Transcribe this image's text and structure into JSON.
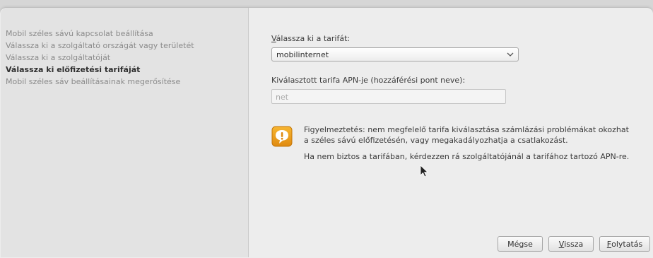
{
  "sidebar": {
    "steps": [
      {
        "label": "Mobil széles sávú kapcsolat beállítása",
        "active": false
      },
      {
        "label": "Válassza ki a szolgáltató országát vagy területét",
        "active": false
      },
      {
        "label": "Válassza ki a szolgáltatóját",
        "active": false
      },
      {
        "label": "Válassza ki előfizetési tarifáját",
        "active": true
      },
      {
        "label": "Mobil széles sáv beállításainak megerősítése",
        "active": false
      }
    ]
  },
  "main": {
    "plan_label_mnemonic": "V",
    "plan_label_rest": "álassza ki a tarifát:",
    "plan_selected": "mobilinternet",
    "apn_label": "Kiválasztott tarifa APN-je (hozzáférési pont neve):",
    "apn_value": "net",
    "warning_line1": "Figyelmeztetés: nem megfelelő tarifa kiválasztása számlázási problémákat okozhat",
    "warning_line2": "a széles sávú előfizetésén, vagy megakadályozhatja a csatlakozást.",
    "warning_line3": "Ha nem biztos a tarifában, kérdezzen rá szolgáltatójánál a tarifához tartozó APN-re."
  },
  "buttons": {
    "cancel": "Mégse",
    "back_mnemonic": "V",
    "back_rest": "issza",
    "continue_mnemonic": "F",
    "continue_rest": "olytatás"
  },
  "icons": {
    "warning": "warning-icon",
    "dropdown": "chevron-down-icon",
    "cursor": "mouse-pointer-icon"
  },
  "colors": {
    "warning_icon": "#f0a020",
    "sidebar_bg": "#e3e3e3",
    "window_bg": "#ededed"
  }
}
